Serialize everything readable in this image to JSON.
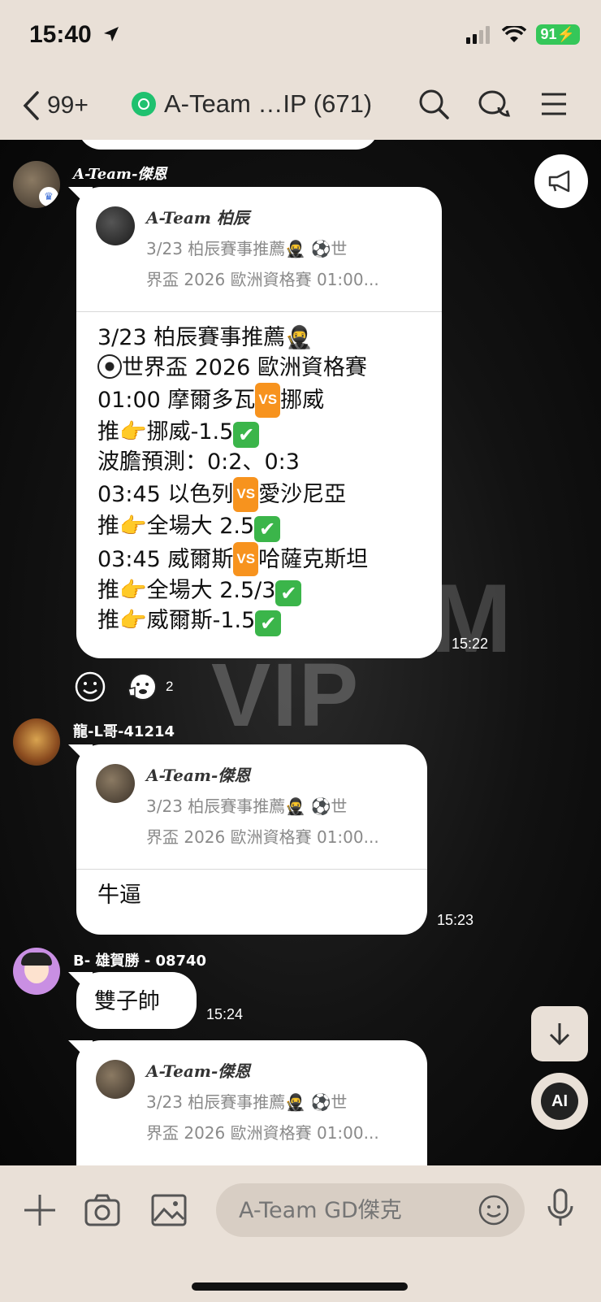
{
  "status": {
    "time": "15:40",
    "battery": "91"
  },
  "header": {
    "back_count": "99+",
    "title": "A-Team …IP (671)"
  },
  "colors": {
    "header_bg": "#e9e0d7",
    "line_green": "#1fc16f",
    "vs_orange": "#f7931e",
    "check_green": "#3bb54a"
  },
  "watermark": {
    "line1": "M",
    "line2": "VIP"
  },
  "messages": [
    {
      "sender": "A-Team-傑恩",
      "time": "15:22",
      "quote": {
        "name": "A-Team 柏辰",
        "line1": "3/23 柏辰賽事推薦🥷 ⚽世",
        "line2": "界盃 2026 歐洲資格賽 01:00..."
      },
      "body": [
        "3/23 柏辰賽事推薦🥷",
        "世界盃 2026 歐洲資格賽",
        "01:00 摩爾多瓦",
        "挪威",
        "推👉挪威-1.5",
        "波膽預測：0:2、0:3",
        "03:45 以色列",
        "愛沙尼亞",
        "推👉全場大 2.5",
        "03:45 威爾斯",
        "哈薩克斯坦",
        "推👉全場大 2.5/3",
        "推👉威爾斯-1.5"
      ],
      "reactions": {
        "count": "2"
      }
    },
    {
      "sender": "龍-L哥-41214",
      "time": "15:23",
      "quote": {
        "name": "A-Team-傑恩",
        "line1": "3/23 柏辰賽事推薦🥷 ⚽世",
        "line2": "界盃 2026 歐洲資格賽 01:00..."
      },
      "body": "牛逼"
    },
    {
      "sender": "B- 雄賀勝 - 08740",
      "time": "15:24",
      "body": "雙子帥"
    },
    {
      "quote": {
        "name": "A-Team-傑恩",
        "line1": "3/23 柏辰賽事推薦🥷 ⚽世",
        "line2": "界盃 2026 歐洲資格賽 01:00..."
      }
    }
  ],
  "vs_label": "VS",
  "input": {
    "placeholder": "A-Team GD傑克"
  },
  "icons": [
    "location-arrow-icon",
    "signal-icon",
    "wifi-icon",
    "battery-icon",
    "chevron-left-icon",
    "search-icon",
    "chat-bubbles-icon",
    "menu-icon",
    "megaphone-icon",
    "smile-icon",
    "reaction-icon",
    "arrow-down-icon",
    "ai-icon",
    "plus-icon",
    "camera-icon",
    "image-icon",
    "emoji-icon",
    "mic-icon"
  ],
  "ai_label": "AI"
}
